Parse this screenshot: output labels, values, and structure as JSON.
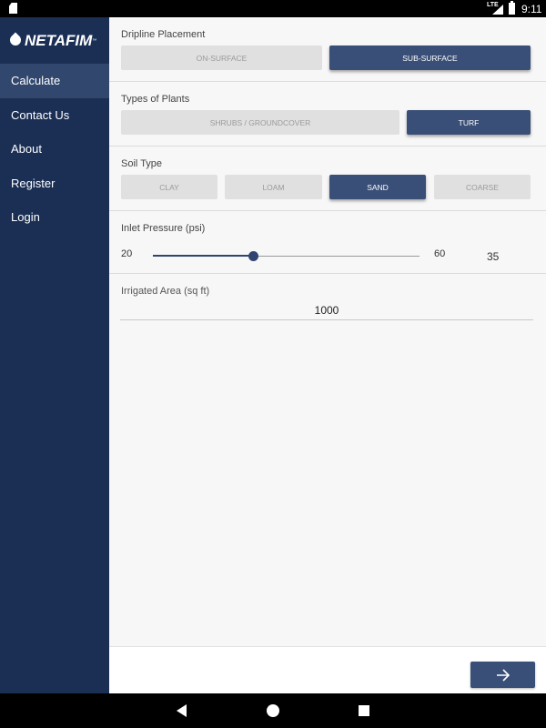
{
  "status_bar": {
    "network": "LTE",
    "time": "9:11"
  },
  "sidebar": {
    "logo_text": "NETAFIM",
    "logo_tm": "™",
    "items": [
      {
        "label": "Calculate",
        "active": true
      },
      {
        "label": "Contact Us",
        "active": false
      },
      {
        "label": "About",
        "active": false
      },
      {
        "label": "Register",
        "active": false
      },
      {
        "label": "Login",
        "active": false
      }
    ]
  },
  "dripline": {
    "title": "Dripline Placement",
    "options": [
      "ON-SURFACE",
      "SUB-SURFACE"
    ],
    "selected": "SUB-SURFACE"
  },
  "plants": {
    "title": "Types of Plants",
    "options": [
      "SHRUBS / GROUNDCOVER",
      "TURF"
    ],
    "selected": "TURF"
  },
  "soil": {
    "title": "Soil Type",
    "options": [
      "CLAY",
      "LOAM",
      "SAND",
      "COARSE"
    ],
    "selected": "SAND"
  },
  "pressure": {
    "title": "Inlet Pressure (psi)",
    "min": "20",
    "max": "60",
    "value": "35"
  },
  "area": {
    "label": "Irrigated Area (sq ft)",
    "value": "1000"
  },
  "colors": {
    "sidebar": "#1b2f55",
    "accent": "#3a4f77",
    "unselected": "#e0e0e0"
  },
  "icons": {
    "next": "arrow-right-icon"
  }
}
